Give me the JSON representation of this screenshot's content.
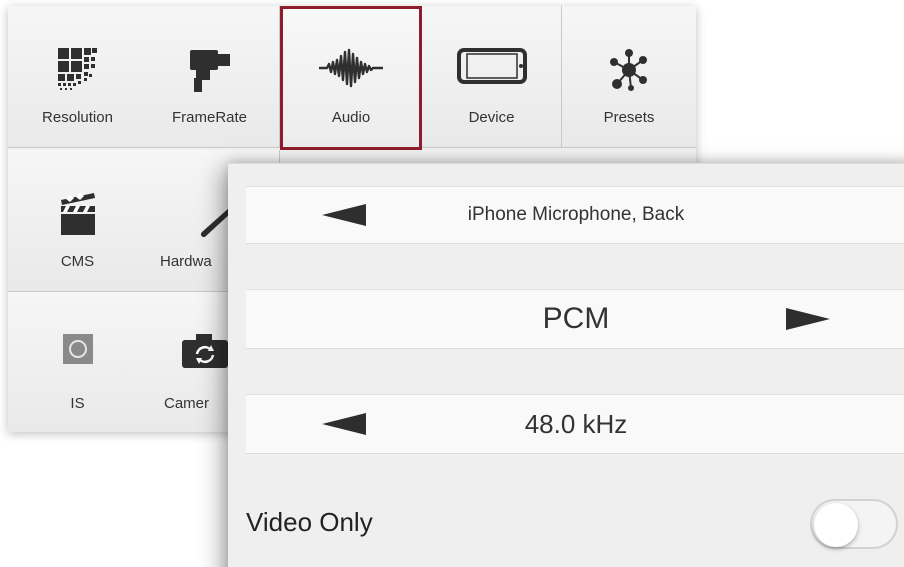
{
  "grid": {
    "items": [
      {
        "label": "Resolution",
        "icon": "resolution-grid-icon",
        "selected": false
      },
      {
        "label": "FrameRate",
        "icon": "video-camera-icon",
        "selected": false
      },
      {
        "label": "Audio",
        "icon": "audio-waveform-icon",
        "selected": true
      },
      {
        "label": "Device",
        "icon": "phone-device-icon",
        "selected": false
      },
      {
        "label": "Presets",
        "icon": "presets-network-icon",
        "selected": false
      },
      {
        "label": "CMS",
        "icon": "clapperboard-icon",
        "selected": false
      },
      {
        "label": "Hardwa",
        "icon": "wrench-icon",
        "selected": false
      },
      {
        "label": "IS",
        "icon": "stabilization-square-icon",
        "selected": false
      },
      {
        "label": "Camer",
        "icon": "camera-switch-icon",
        "selected": false
      }
    ],
    "selected_color": "#8e1c2c"
  },
  "audio_settings": {
    "input_source": "iPhone Microphone, Back",
    "format": "PCM",
    "sample_rate": "48.0 kHz",
    "video_only_label": "Video Only",
    "video_only_enabled": false
  }
}
